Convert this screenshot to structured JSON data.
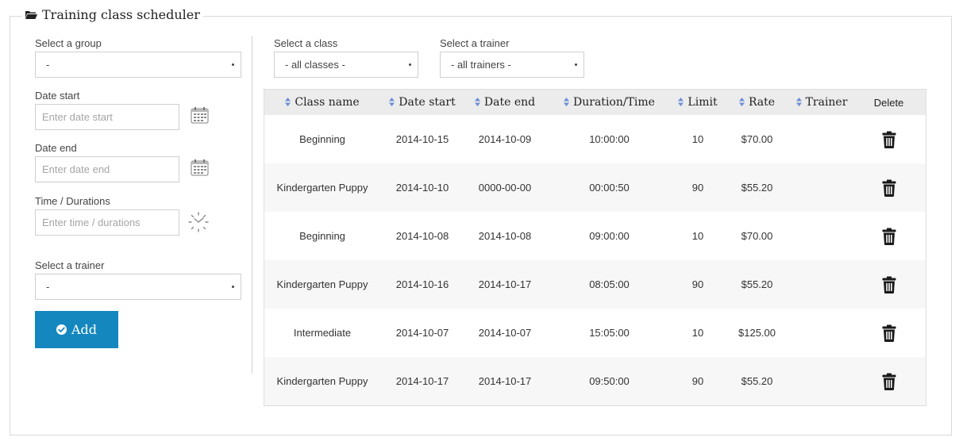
{
  "title": "Training class scheduler",
  "left_panel": {
    "group_label": "Select a group",
    "group_value": "-",
    "date_start_label": "Date start",
    "date_start_placeholder": "Enter date start",
    "date_end_label": "Date end",
    "date_end_placeholder": "Enter date end",
    "time_label": "Time / Durations",
    "time_placeholder": "Enter time / durations",
    "trainer_label": "Select a trainer",
    "trainer_value": "-",
    "add_label": "Add"
  },
  "filters": {
    "class_label": "Select a class",
    "class_value": "- all classes -",
    "trainer_label": "Select a trainer",
    "trainer_value": "- all trainers -"
  },
  "table": {
    "columns": [
      "Class name",
      "Date start",
      "Date end",
      "Duration/Time",
      "Limit",
      "Rate",
      "Trainer",
      "Delete"
    ],
    "rows": [
      {
        "class_name": "Beginning",
        "date_start": "2014-10-15",
        "date_end": "2014-10-09",
        "duration": "10:00:00",
        "limit": "10",
        "rate": "$70.00",
        "trainer": ""
      },
      {
        "class_name": "Kindergarten Puppy",
        "date_start": "2014-10-10",
        "date_end": "0000-00-00",
        "duration": "00:00:50",
        "limit": "90",
        "rate": "$55.20",
        "trainer": ""
      },
      {
        "class_name": "Beginning",
        "date_start": "2014-10-08",
        "date_end": "2014-10-08",
        "duration": "09:00:00",
        "limit": "10",
        "rate": "$70.00",
        "trainer": ""
      },
      {
        "class_name": "Kindergarten Puppy",
        "date_start": "2014-10-16",
        "date_end": "2014-10-17",
        "duration": "08:05:00",
        "limit": "90",
        "rate": "$55.20",
        "trainer": ""
      },
      {
        "class_name": "Intermediate",
        "date_start": "2014-10-07",
        "date_end": "2014-10-07",
        "duration": "15:05:00",
        "limit": "10",
        "rate": "$125.00",
        "trainer": ""
      },
      {
        "class_name": "Kindergarten Puppy",
        "date_start": "2014-10-17",
        "date_end": "2014-10-17",
        "duration": "09:50:00",
        "limit": "90",
        "rate": "$55.20",
        "trainer": ""
      }
    ]
  },
  "icons": {
    "legend": "folder-open-icon",
    "date": "calendar-icon",
    "time": "clock-icon",
    "add": "check-circle-icon",
    "sort": "sort-icon",
    "delete": "trash-icon"
  },
  "colors": {
    "accent": "#1487bf",
    "sort_arrow": "#6b8fd6"
  }
}
